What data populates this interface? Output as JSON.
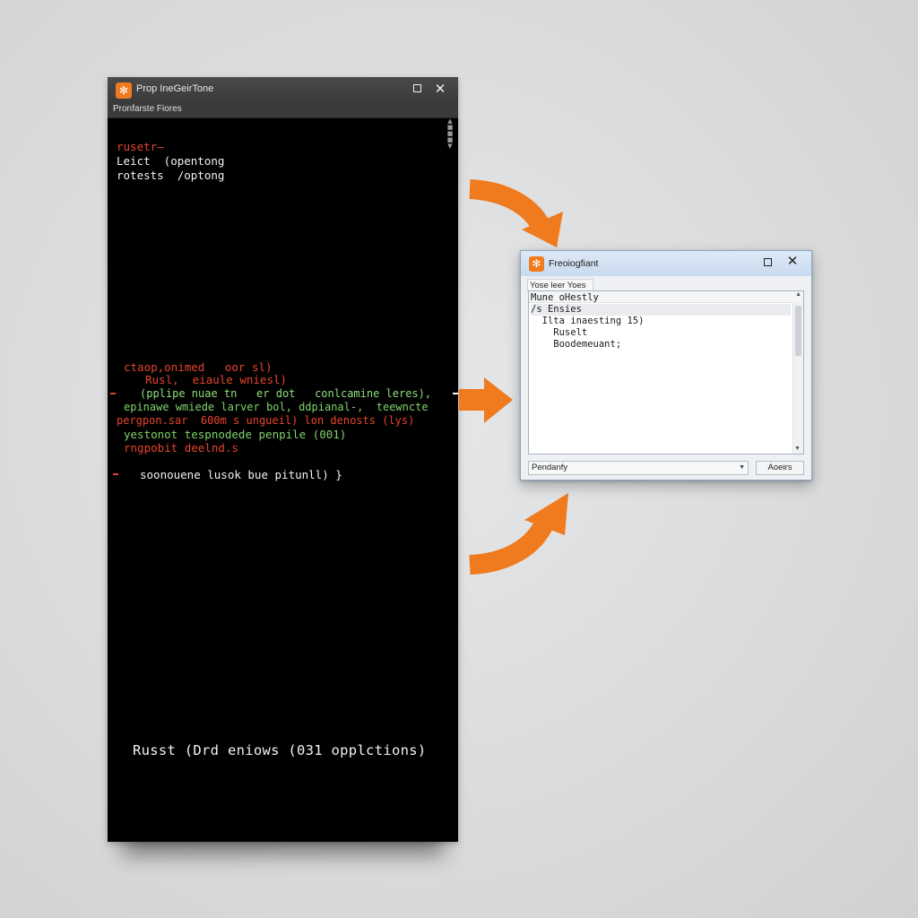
{
  "terminal": {
    "title": "Prop IneGeirTone",
    "menu": "Pronfarste Fiores",
    "lines_top": [
      {
        "text": "rusetr–",
        "color": "red"
      },
      {
        "text": "Leict  (opentong",
        "color": "white"
      },
      {
        "text": "rotests  /optong",
        "color": "white"
      }
    ],
    "lines_mid": [
      {
        "text": "ctaop,onimed   oor sl)",
        "color": "red"
      },
      {
        "text": "Rusl,  eiaule wniesl)",
        "color": "red"
      },
      {
        "text": "(pplipe nuae tn   er dot   conlcamine leres),",
        "color": "green"
      },
      {
        "text": "epinawe wmiede larver bol, ddpianal-,  teewncte",
        "color": "green2"
      },
      {
        "text": "pergpon.sar  600m s ungueil) lon denosts (lys)",
        "color": "red"
      },
      {
        "text": "yestonot tespnodede penpile (001)",
        "color": "green2"
      },
      {
        "text": "rngpobit deelnd.s",
        "color": "red"
      },
      {
        "text": "soonouene lusok bue pitunll) }",
        "color": "white"
      }
    ],
    "footer": "Russt (Drd eniows (031 opplctions)"
  },
  "dialog": {
    "title": "Freoiogfiant",
    "tab": "Yose leer Yoes",
    "list_items": [
      "Mune oHestly",
      "/s Ensies",
      "  Ilta inaesting 15)",
      "    Ruselt",
      "    Boodemeuant;"
    ],
    "selected_index": 1,
    "dropdown_value": "Pendanfy",
    "button_label": "Aoeirs"
  },
  "colors": {
    "terminal_bg": "#000000",
    "accent_orange": "#f07a1e",
    "text_red": "#e8442c",
    "text_green": "#8fe07a",
    "dialog_titlebar": "#c9dbef"
  },
  "icons": {
    "app_icon": "orange-app-icon",
    "maximize": "maximize-icon",
    "close": "close-icon",
    "flow_arrows": [
      "curved-arrow-down-icon",
      "straight-arrow-right-icon",
      "curved-arrow-up-icon"
    ]
  }
}
